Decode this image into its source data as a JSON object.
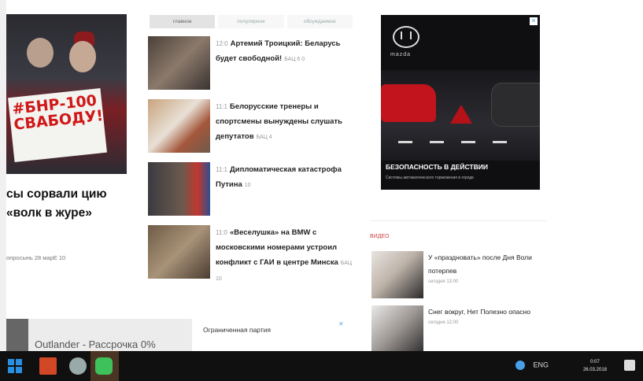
{
  "main": {
    "title": "сы сорвали цию «волк в журе»",
    "meta": "опросынь 28 марЕ 10"
  },
  "photo_sign": "#БНР-100 СВАБОДУ!",
  "tabs": [
    "главное",
    "популярное",
    "обсуждаемое"
  ],
  "news": [
    {
      "time": "12:0",
      "title": "Артемий Троицкий: Беларусь будет свободной!",
      "count": "БАЦ 6 0"
    },
    {
      "time": "11:1",
      "title": "Белорусские тренеры и спортсмены вынуждены слушать депутатов",
      "count": "БАЦ 4"
    },
    {
      "time": "11:1",
      "title": "Дипломатическая катастрофа Путина",
      "count": "10"
    },
    {
      "time": "11:0",
      "title": "«Веселушка» на BMW с московскими номерами устроил конфликт с ГАИ в центре Минска",
      "count": "БАЦ 10"
    }
  ],
  "ad": {
    "brand": "mazda",
    "headline": "БЕЗОПАСНОСТЬ В ДЕЙСТВИИ",
    "sub": "Системы автоматического торможения в городе",
    "close": "✕"
  },
  "rcol": {
    "label": "ВИДЕО",
    "items": [
      {
        "title": "У «праздновать» после Дня Воли потерпев",
        "time": "сегодня 13:00"
      },
      {
        "title": "Снег вокруг, Нет Полезно опасно",
        "time": "сегодня 12:00"
      }
    ]
  },
  "bottom_ad": {
    "text": "Outlander - Рассрочка 0%",
    "right_text": "Ограниченная партия",
    "close": "✕"
  },
  "taskbar": {
    "tray_text": "ENG",
    "time": "0:07",
    "date": "26.03.2018"
  }
}
